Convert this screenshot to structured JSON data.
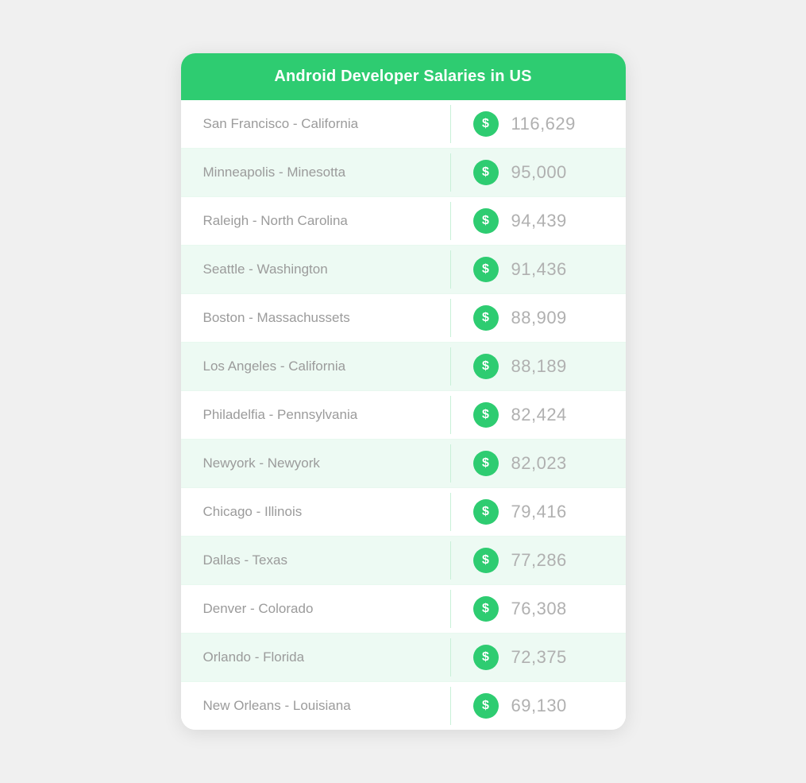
{
  "header": {
    "title": "Android Developer Salaries in US"
  },
  "rows": [
    {
      "city": "San Francisco - California",
      "salary": "116,629",
      "shaded": false
    },
    {
      "city": "Minneapolis - Minesotta",
      "salary": "95,000",
      "shaded": true
    },
    {
      "city": "Raleigh - North Carolina",
      "salary": "94,439",
      "shaded": false
    },
    {
      "city": "Seattle - Washington",
      "salary": "91,436",
      "shaded": true
    },
    {
      "city": "Boston - Massachussets",
      "salary": "88,909",
      "shaded": false
    },
    {
      "city": "Los Angeles - California",
      "salary": "88,189",
      "shaded": true
    },
    {
      "city": "Philadelfia - Pennsylvania",
      "salary": "82,424",
      "shaded": false
    },
    {
      "city": "Newyork - Newyork",
      "salary": "82,023",
      "shaded": true
    },
    {
      "city": "Chicago - Illinois",
      "salary": "79,416",
      "shaded": false
    },
    {
      "city": "Dallas - Texas",
      "salary": "77,286",
      "shaded": true
    },
    {
      "city": "Denver - Colorado",
      "salary": "76,308",
      "shaded": false
    },
    {
      "city": "Orlando - Florida",
      "salary": "72,375",
      "shaded": true
    },
    {
      "city": "New Orleans - Louisiana",
      "salary": "69,130",
      "shaded": false
    }
  ],
  "dollar_symbol": "$"
}
